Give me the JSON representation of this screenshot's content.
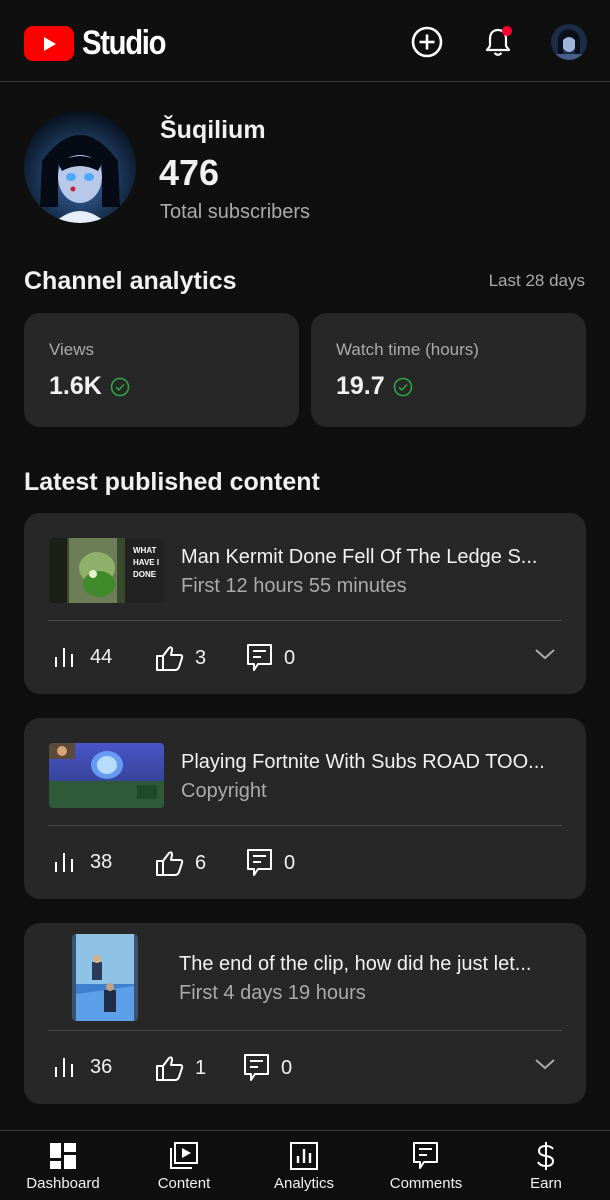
{
  "header": {
    "app_name": "Studio",
    "icons": [
      "youtube-logo-icon",
      "create-icon",
      "notifications-icon",
      "account-avatar"
    ]
  },
  "channel": {
    "name": "Šuqilium",
    "subscribers": "476",
    "subscribers_label": "Total subscribers"
  },
  "analytics": {
    "title": "Channel analytics",
    "period": "Last 28 days",
    "metrics": [
      {
        "label": "Views",
        "value": "1.6K"
      },
      {
        "label": "Watch time (hours)",
        "value": "19.7"
      }
    ]
  },
  "latest": {
    "title": "Latest published content",
    "videos": [
      {
        "title": "Man Kermit Done Fell Of The Ledge S...",
        "subtitle": "First 12 hours 55 minutes",
        "views": "44",
        "likes": "3",
        "comments": "0",
        "thumb_text": [
          "WHAT",
          "HAVE I",
          "DONE"
        ]
      },
      {
        "title": "Playing Fortnite With Subs ROAD TOO...",
        "subtitle": "Copyright",
        "views": "38",
        "likes": "6",
        "comments": "0"
      },
      {
        "title": "The end of the clip, how did he just let...",
        "subtitle": "First 4 days 19 hours",
        "views": "36",
        "likes": "1",
        "comments": "0"
      }
    ]
  },
  "nav": {
    "items": [
      {
        "label": "Dashboard"
      },
      {
        "label": "Content"
      },
      {
        "label": "Analytics"
      },
      {
        "label": "Comments"
      },
      {
        "label": "Earn"
      }
    ]
  },
  "colors": {
    "background": "#0f0f0f",
    "card": "#272727",
    "brand_red": "#ff0000",
    "check_green": "#2ba640",
    "secondary_text": "#aaaaaa"
  }
}
